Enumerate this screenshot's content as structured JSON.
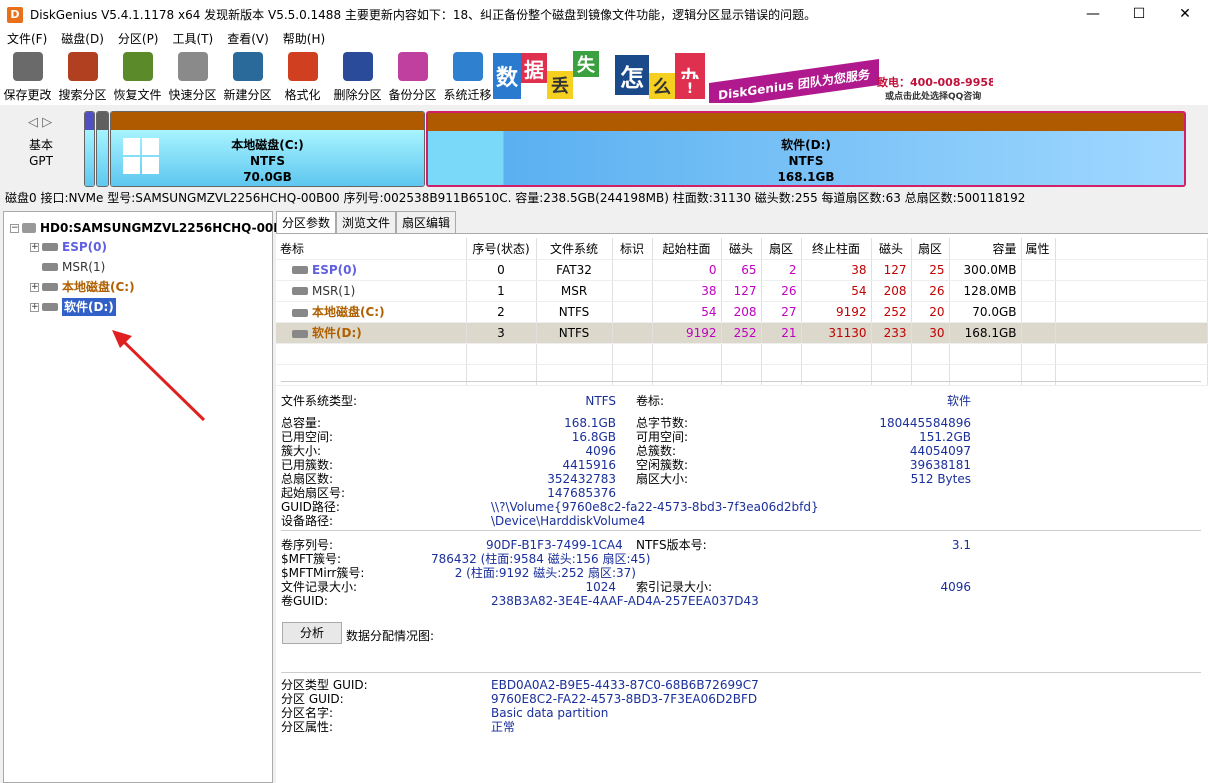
{
  "titlebar": {
    "text": "DiskGenius V5.4.1.1178 x64    发现新版本 V5.5.0.1488    主要更新内容如下：18、纠正备份整个磁盘到镜像文件功能，逻辑分区显示错误的问题。",
    "min": "—",
    "max": "☐",
    "close": "✕"
  },
  "menu": [
    "文件(F)",
    "磁盘(D)",
    "分区(P)",
    "工具(T)",
    "查看(V)",
    "帮助(H)"
  ],
  "toolbar": [
    {
      "label": "保存更改",
      "icon": "save-icon",
      "color": "#6a6a6a"
    },
    {
      "label": "搜索分区",
      "icon": "search-icon",
      "color": "#b04020"
    },
    {
      "label": "恢复文件",
      "icon": "recover-icon",
      "color": "#5a8a2a"
    },
    {
      "label": "快速分区",
      "icon": "quick-partition-icon",
      "color": "#8a8a8a"
    },
    {
      "label": "新建分区",
      "icon": "new-partition-icon",
      "color": "#2a6a9a"
    },
    {
      "label": "格式化",
      "icon": "format-icon",
      "color": "#d04020"
    },
    {
      "label": "删除分区",
      "icon": "delete-icon",
      "color": "#2a4a9a"
    },
    {
      "label": "备份分区",
      "icon": "backup-icon",
      "color": "#c040a0"
    },
    {
      "label": "系统迁移",
      "icon": "migrate-icon",
      "color": "#3080d0"
    }
  ],
  "banner": {
    "chars": [
      "数",
      "据",
      "丢",
      "失",
      "怎",
      "么",
      "办",
      "!"
    ],
    "slogan": "DiskGenius 团队为您服务",
    "phone": "致电：400-008-9958",
    "qq": "或点击此处选择QQ咨询"
  },
  "diskmap": {
    "nav": "◁ ▷",
    "type_line1": "基本",
    "type_line2": "GPT",
    "c": {
      "name": "本地磁盘(C:)",
      "fs": "NTFS",
      "size": "70.0GB"
    },
    "d": {
      "name": "软件(D:)",
      "fs": "NTFS",
      "size": "168.1GB"
    }
  },
  "infobar": "磁盘0 接口:NVMe  型号:SAMSUNGMZVL2256HCHQ-00B00  序列号:002538B911B6510C.  容量:238.5GB(244198MB)  柱面数:31130  磁头数:255  每道扇区数:63  总扇区数:500118192",
  "tree": {
    "root": "HD0:SAMSUNGMZVL2256HCHQ-00B",
    "items": [
      {
        "label": "ESP(0)",
        "color": "#6060e0",
        "expand": "+"
      },
      {
        "label": "MSR(1)",
        "color": "#333333",
        "expand": ""
      },
      {
        "label": "本地磁盘(C:)",
        "color": "#b06000",
        "expand": "+"
      },
      {
        "label": "软件(D:)",
        "color": "#ffffff",
        "expand": "+"
      }
    ]
  },
  "tabs": [
    "分区参数",
    "浏览文件",
    "扇区编辑"
  ],
  "table": {
    "headers": [
      "卷标",
      "序号(状态)",
      "文件系统",
      "标识",
      "起始柱面",
      "磁头",
      "扇区",
      "终止柱面",
      "磁头",
      "扇区",
      "容量",
      "属性"
    ],
    "rows": [
      {
        "label": "ESP(0)",
        "color": "#6060e0",
        "cells": [
          "0",
          "FAT32",
          "",
          "0",
          "65",
          "2",
          "38",
          "127",
          "25",
          "300.0MB",
          ""
        ]
      },
      {
        "label": "MSR(1)",
        "color": "#333333",
        "cells": [
          "1",
          "MSR",
          "",
          "38",
          "127",
          "26",
          "54",
          "208",
          "26",
          "128.0MB",
          ""
        ]
      },
      {
        "label": "本地磁盘(C:)",
        "color": "#b06000",
        "cells": [
          "2",
          "NTFS",
          "",
          "54",
          "208",
          "27",
          "9192",
          "252",
          "20",
          "70.0GB",
          ""
        ]
      },
      {
        "label": "软件(D:)",
        "color": "#b06000",
        "cells": [
          "3",
          "NTFS",
          "",
          "9192",
          "252",
          "21",
          "31130",
          "233",
          "30",
          "168.1GB",
          ""
        ]
      }
    ]
  },
  "details": {
    "fs_type_label": "文件系统类型:",
    "fs_type": "NTFS",
    "vol_label_label": "卷标:",
    "vol_label": "软件",
    "left": [
      [
        "总容量:",
        "168.1GB"
      ],
      [
        "已用空间:",
        "16.8GB"
      ],
      [
        "簇大小:",
        "4096"
      ],
      [
        "已用簇数:",
        "4415916"
      ],
      [
        "总扇区数:",
        "352432783"
      ],
      [
        "起始扇区号:",
        "147685376"
      ]
    ],
    "right": [
      [
        "总字节数:",
        "180445584896"
      ],
      [
        "可用空间:",
        "151.2GB"
      ],
      [
        "总簇数:",
        "44054097"
      ],
      [
        "空闲簇数:",
        "39638181"
      ],
      [
        "扇区大小:",
        "512 Bytes"
      ]
    ],
    "guid_path_label": "GUID路径:",
    "guid_path": "\\\\?\\Volume{9760e8c2-fa22-4573-8bd3-7f3ea06d2bfd}",
    "dev_path_label": "设备路径:",
    "dev_path": "\\Device\\HarddiskVolume4",
    "serial_label": "卷序列号:",
    "serial": "90DF-B1F3-7499-1CA4",
    "ntfs_ver_label": "NTFS版本号:",
    "ntfs_ver": "3.1",
    "mft_label": "$MFT簇号:",
    "mft": "786432 (柱面:9584 磁头:156 扇区:45)",
    "mftmirr_label": "$MFTMirr簇号:",
    "mftmirr": "2 (柱面:9192 磁头:252 扇区:37)",
    "rec_size_label": "文件记录大小:",
    "rec_size": "1024",
    "idx_size_label": "索引记录大小:",
    "idx_size": "4096",
    "vol_guid_label": "卷GUID:",
    "vol_guid": "238B3A82-3E4E-4AAF-AD4A-257EEA037D43",
    "analyze_btn": "分析",
    "dist_label": "数据分配情况图:",
    "ptype_guid_label": "分区类型 GUID:",
    "ptype_guid": "EBD0A0A2-B9E5-4433-87C0-68B6B72699C7",
    "p_guid_label": "分区 GUID:",
    "p_guid": "9760E8C2-FA22-4573-8BD3-7F3EA06D2BFD",
    "p_name_label": "分区名字:",
    "p_name": "Basic data partition",
    "p_attr_label": "分区属性:",
    "p_attr": "正常"
  }
}
